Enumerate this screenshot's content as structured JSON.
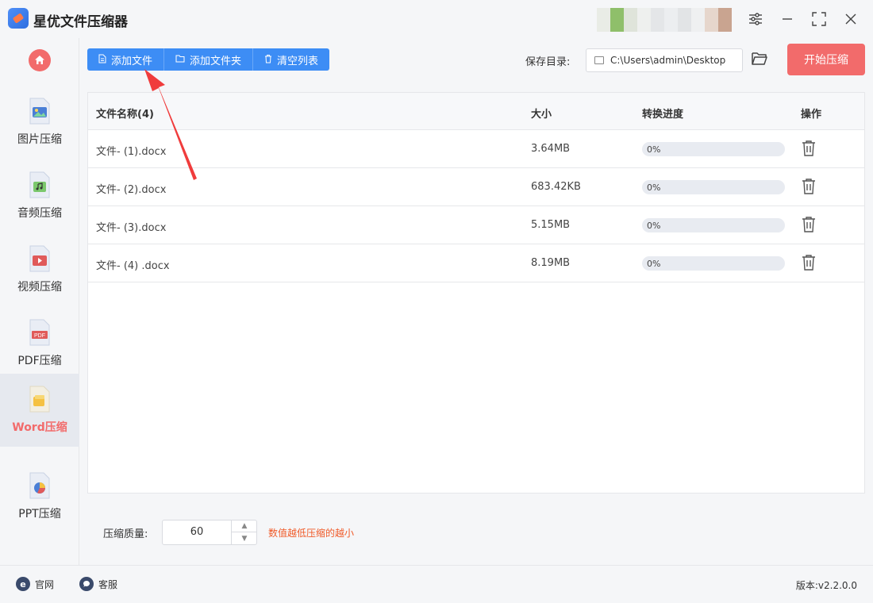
{
  "app": {
    "title": "星优文件压缩器"
  },
  "window_controls": {
    "settings_icon": "sliders-icon",
    "minimize_icon": "minimize-icon",
    "maximize_icon": "maximize-icon",
    "close_icon": "close-icon"
  },
  "sidebar": {
    "home_icon": "home-icon",
    "items": [
      {
        "label": "图片压缩",
        "icon": "image-file-icon",
        "active": false
      },
      {
        "label": "音频压缩",
        "icon": "audio-file-icon",
        "active": false
      },
      {
        "label": "视频压缩",
        "icon": "video-file-icon",
        "active": false
      },
      {
        "label": "PDF压缩",
        "icon": "pdf-file-icon",
        "active": false
      },
      {
        "label": "Word压缩",
        "icon": "word-file-icon",
        "active": true
      },
      {
        "label": "PPT压缩",
        "icon": "ppt-file-icon",
        "active": false
      }
    ]
  },
  "toolbar": {
    "add_file": "添加文件",
    "add_folder": "添加文件夹",
    "clear_list": "清空列表",
    "save_dir_label": "保存目录:",
    "save_dir_value": "C:\\Users\\admin\\Desktop",
    "start_button": "开始压缩"
  },
  "table": {
    "headers": {
      "name": "文件名称(4)",
      "size": "大小",
      "progress": "转换进度",
      "action": "操作"
    },
    "rows": [
      {
        "name": "文件- (1).docx",
        "size": "3.64MB",
        "progress": 0,
        "progress_text": "0%"
      },
      {
        "name": "文件- (2).docx",
        "size": "683.42KB",
        "progress": 0,
        "progress_text": "0%"
      },
      {
        "name": "文件- (3).docx",
        "size": "5.15MB",
        "progress": 0,
        "progress_text": "0%"
      },
      {
        "name": "文件- (4) .docx",
        "size": "8.19MB",
        "progress": 0,
        "progress_text": "0%"
      }
    ]
  },
  "settings": {
    "quality_label": "压缩质量:",
    "quality_value": "60",
    "hint": "数值越低压缩的越小"
  },
  "footer": {
    "website": "官网",
    "support": "客服",
    "version": "版本:v2.2.0.0"
  },
  "colors": {
    "accent_blue": "#3d8df5",
    "accent_red": "#f26b6b",
    "hint_orange": "#f05a28"
  }
}
